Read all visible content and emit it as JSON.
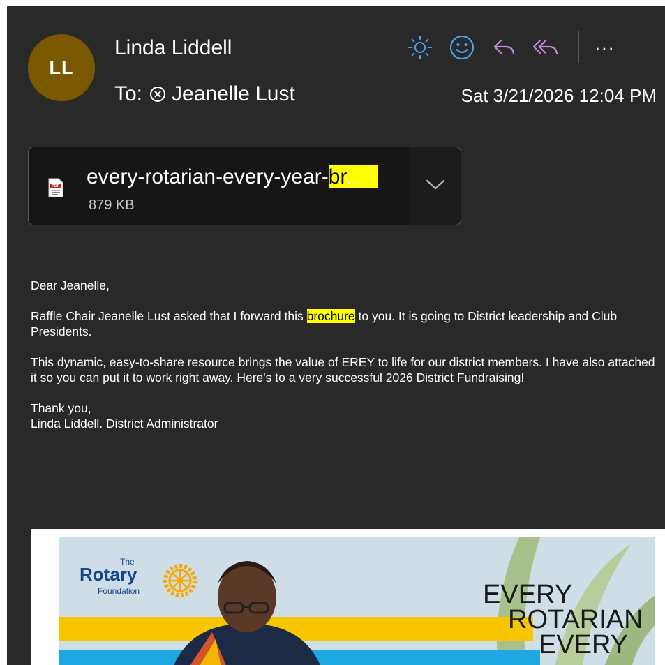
{
  "sender": {
    "initials": "LL",
    "name": "Linda Liddell",
    "avatar_color": "#7a5800"
  },
  "recipients": {
    "label": "To:",
    "items": [
      {
        "name": "Jeanelle Lust"
      }
    ]
  },
  "date": "Sat 3/21/2026 12:04 PM",
  "toolbar": {
    "icons": [
      "sun-icon",
      "emoji-icon",
      "reply-icon",
      "reply-all-icon",
      "more-icon"
    ],
    "more_label": "···",
    "accent_blue": "#4aa3f0",
    "accent_purple": "#c08bd6"
  },
  "attachment": {
    "name_prefix": "every-rotarian-every-year-",
    "name_highlight": "br",
    "name_ellipsis": "...",
    "size": "879 KB",
    "type_icon": "pdf-icon"
  },
  "message": {
    "greeting": "Dear Jeanelle,",
    "p1_before": "Raffle Chair Jeanelle Lust asked that I forward this ",
    "p1_highlight": "brochure",
    "p1_after": " to you.  It is going to District leadership and Club Presidents.",
    "p2": "This dynamic, easy-to-share resource brings the value of EREY to life for our district members. I have also attached it so you can put it to work right away.  Here's to a very successful 2026 District Fundraising!",
    "closing": "Thank you,",
    "signature": "Linda Liddell. District Administrator",
    "highlight_color": "#ffff00"
  },
  "brochure": {
    "logo_the": "The",
    "logo_rotary": "Rotary",
    "logo_foundation": "Foundation",
    "title_lines": [
      "EVERY",
      "ROTARIAN",
      "EVERY"
    ],
    "brand_blue": "#17458f",
    "yellow": "#f7c600",
    "cyan": "#1ea7e0"
  }
}
